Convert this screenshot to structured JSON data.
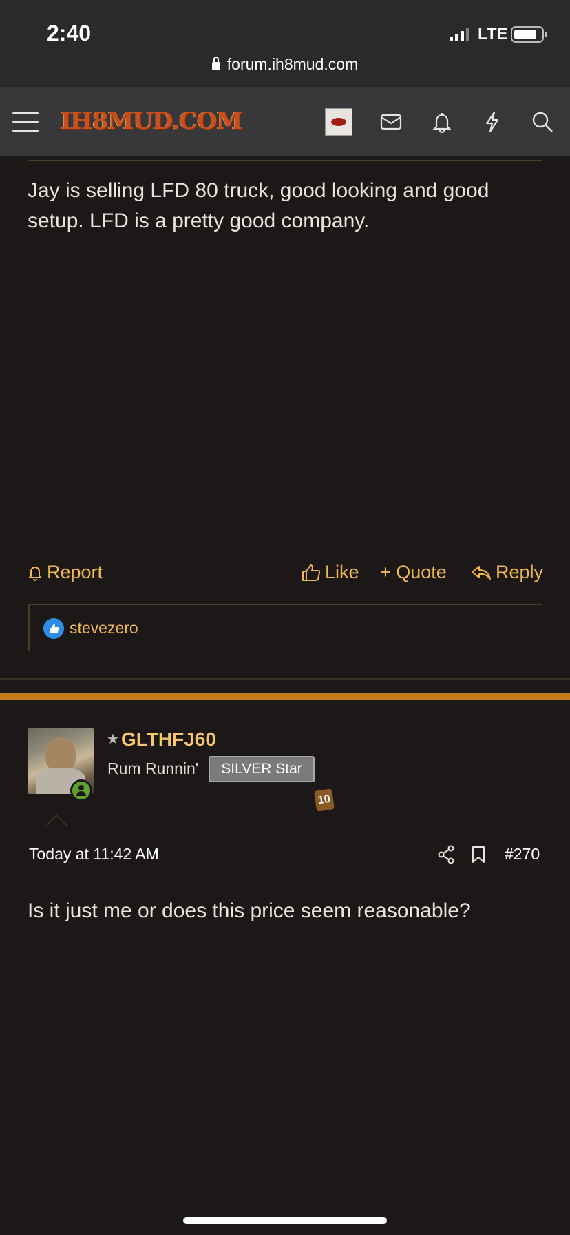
{
  "status_bar": {
    "time": "2:40",
    "network": "LTE",
    "url": "forum.ih8mud.com"
  },
  "header": {
    "logo_text": "IH8MUD.COM"
  },
  "post1": {
    "text": "Jay is selling LFD 80 truck, good looking and good setup. LFD is a pretty good company.",
    "actions": {
      "report": "Report",
      "like": "Like",
      "quote": "+ Quote",
      "reply": "Reply"
    },
    "liked_by": "stevezero"
  },
  "post2": {
    "username": "GLTHFJ60",
    "user_title": "Rum Runnin'",
    "banner": "SILVER Star",
    "trophy_points": "10",
    "date": "Today at 11:42 AM",
    "post_number": "#270",
    "text": "Is it just me or does this price seem reasonable?"
  },
  "colors": {
    "accent": "#f0b84f",
    "username": "#f6c66a",
    "separator": "#c57a1c",
    "background": "#1c1817"
  },
  "icons": [
    "hamburger-icon",
    "avatar-icon",
    "envelope-icon",
    "bell-icon",
    "bolt-icon",
    "search-icon",
    "thumbs-up-icon",
    "reply-icon",
    "share-icon",
    "bookmark-icon"
  ]
}
